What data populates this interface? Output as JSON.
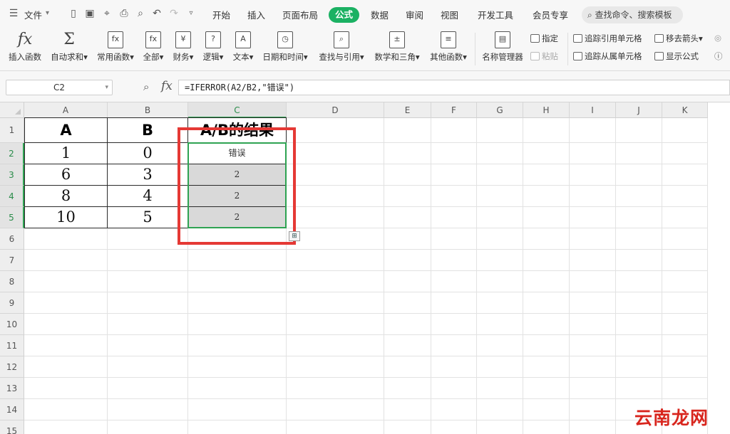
{
  "menubar": {
    "file_label": "文件",
    "tabs": [
      "开始",
      "插入",
      "页面布局",
      "公式",
      "数据",
      "审阅",
      "视图",
      "开发工具",
      "会员专享"
    ],
    "active_tab": "公式",
    "search_text": "查找命令、搜索模板",
    "accent_color": "#1bb163"
  },
  "ribbon": {
    "buttons": [
      {
        "label": "插入函数",
        "icon": "fx-icon"
      },
      {
        "label": "自动求和▾",
        "icon": "sigma-icon"
      },
      {
        "label": "常用函数▾",
        "icon": "fx-star-icon"
      },
      {
        "label": "全部▾",
        "icon": "fx-book-icon"
      },
      {
        "label": "财务▾",
        "icon": "yen-icon"
      },
      {
        "label": "逻辑▾",
        "icon": "question-icon"
      },
      {
        "label": "文本▾",
        "icon": "text-a-icon"
      },
      {
        "label": "日期和时间▾",
        "icon": "clock-icon"
      },
      {
        "label": "查找与引用▾",
        "icon": "magnifier-book-icon"
      },
      {
        "label": "数学和三角▾",
        "icon": "math-icon"
      },
      {
        "label": "其他函数▾",
        "icon": "more-functions-icon"
      },
      {
        "label": "名称管理器",
        "icon": "name-manager-icon"
      }
    ],
    "small": {
      "specify": "指定",
      "paste": "粘贴",
      "trace_precedents": "追踪引用单元格",
      "trace_dependents": "追踪从属单元格",
      "remove_arrows": "移去箭头▾",
      "show_formulas": "显示公式"
    }
  },
  "formula_bar": {
    "cell_ref": "C2",
    "formula": "=IFERROR(A2/B2,\"错误\")"
  },
  "columns": [
    "A",
    "B",
    "C",
    "D",
    "E",
    "F",
    "G",
    "H",
    "I",
    "J",
    "K"
  ],
  "rows": [
    "1",
    "2",
    "3",
    "4",
    "5",
    "6",
    "7",
    "8",
    "9",
    "10",
    "11",
    "12",
    "13",
    "14",
    "15"
  ],
  "table": {
    "headers": [
      "A",
      "B",
      "A/B的结果"
    ],
    "data": [
      [
        "1",
        "0",
        "错误"
      ],
      [
        "6",
        "3",
        "2"
      ],
      [
        "8",
        "4",
        "2"
      ],
      [
        "10",
        "5",
        "2"
      ]
    ]
  },
  "highlight_color": "#e53935",
  "selection_color": "#2ea352",
  "watermark": "云南龙网"
}
